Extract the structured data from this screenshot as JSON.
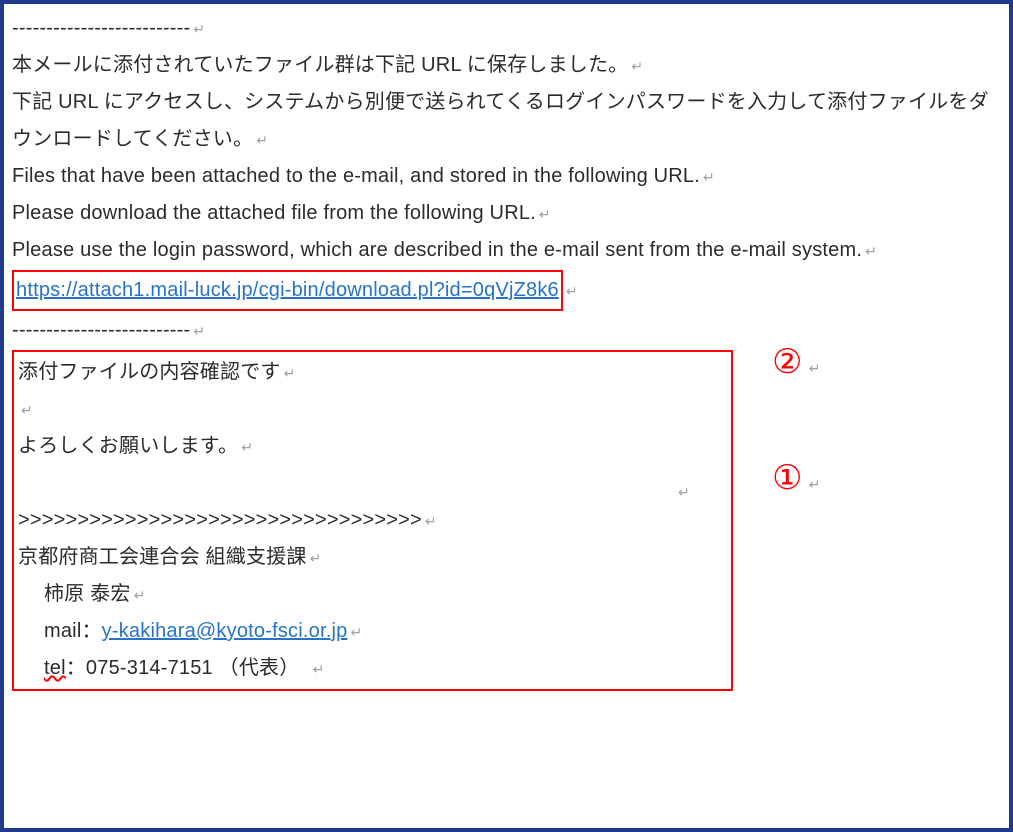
{
  "separator_top": "--------------------------",
  "jp_line1": "本メールに添付されていたファイル群は下記 URL に保存しました。",
  "jp_line2": "下記 URL にアクセスし、システムから別便で送られてくるログインパスワードを入力して添付ファイルをダウンロードしてください。",
  "en_line1": "Files that have been attached to the e-mail, and stored in the following URL.",
  "en_line2": "Please download the attached file from the following URL.",
  "en_line3": "Please use the login password, which are described in the e-mail sent from the e-mail system.",
  "download_url": "https://attach1.mail-luck.jp/cgi-bin/download.pl?id=0qVjZ8k6",
  "separator_bottom": "--------------------------",
  "body_line1": "添付ファイルの内容確認です",
  "body_line2": "よろしくお願いします。",
  "chevrons": ">>>>>>>>>>>>>>>>>>>>>>>>>>>>>>>>>>",
  "sig_org": "京都府商工会連合会  組織支援課",
  "sig_name": "柿原  泰宏",
  "sig_mail_label": "mail：",
  "sig_mail_value": "y-kakihara@kyoto-fsci.or.jp",
  "sig_tel_label": "tel",
  "sig_tel_rest": "：075-314-7151 （代表）　",
  "enter_mark": "↵",
  "annotation_1": "①",
  "annotation_2": "②"
}
